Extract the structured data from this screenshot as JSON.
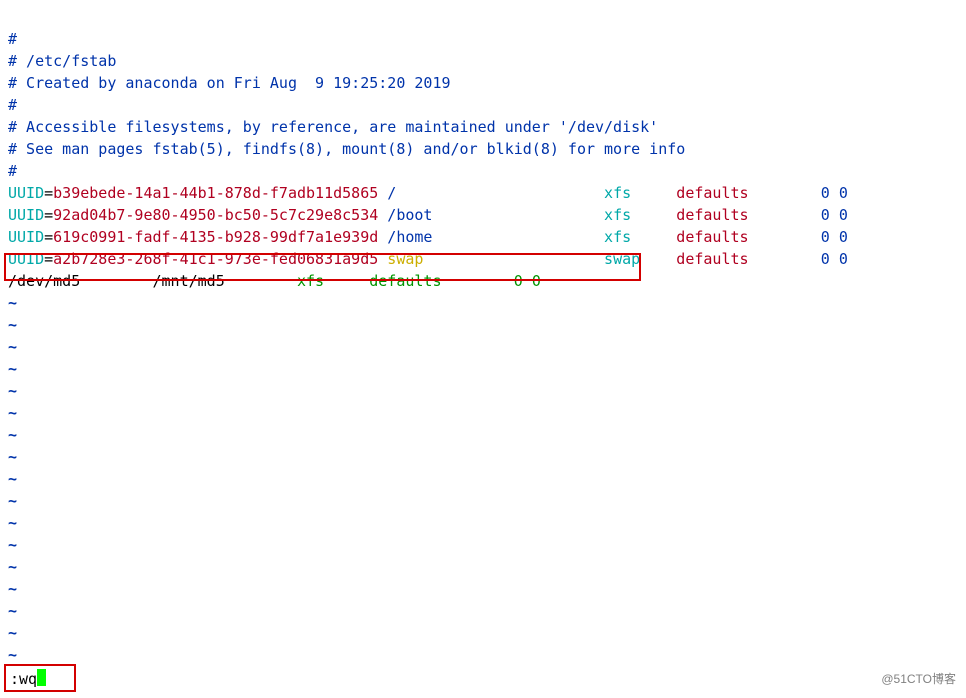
{
  "comments": {
    "l1": "#",
    "l2": "# /etc/fstab",
    "l3": "# Created by anaconda on Fri Aug  9 19:25:20 2019",
    "l4": "#",
    "l5": "# Accessible filesystems, by reference, are maintained under '/dev/disk'",
    "l6": "# See man pages fstab(5), findfs(8), mount(8) and/or blkid(8) for more info",
    "l7": "#"
  },
  "label": {
    "uuid": "UUID",
    "eq": "="
  },
  "entries": [
    {
      "uuid": "b39ebede-14a1-44b1-878d-f7adb11d5865",
      "mount": "/",
      "fs": "xfs",
      "opts": "defaults",
      "d1": "0",
      "d2": "0"
    },
    {
      "uuid": "92ad04b7-9e80-4950-bc50-5c7c29e8c534",
      "mount": "/boot",
      "fs": "xfs",
      "opts": "defaults",
      "d1": "0",
      "d2": "0"
    },
    {
      "uuid": "619c0991-fadf-4135-b928-99df7a1e939d",
      "mount": "/home",
      "fs": "xfs",
      "opts": "defaults",
      "d1": "0",
      "d2": "0"
    },
    {
      "uuid": "a2b728e3-268f-41c1-973e-fed06831a9d5",
      "mount": "swap",
      "fs": "swap",
      "opts": "defaults",
      "d1": "0",
      "d2": "0"
    }
  ],
  "new_entry": {
    "dev": "/dev/md5",
    "mount": "/mnt/md5",
    "fs": "xfs",
    "opts": "defaults",
    "d1": "0",
    "d2": "0"
  },
  "tilde": "~",
  "cmd": ":wq",
  "watermark": "@51CTO博客"
}
